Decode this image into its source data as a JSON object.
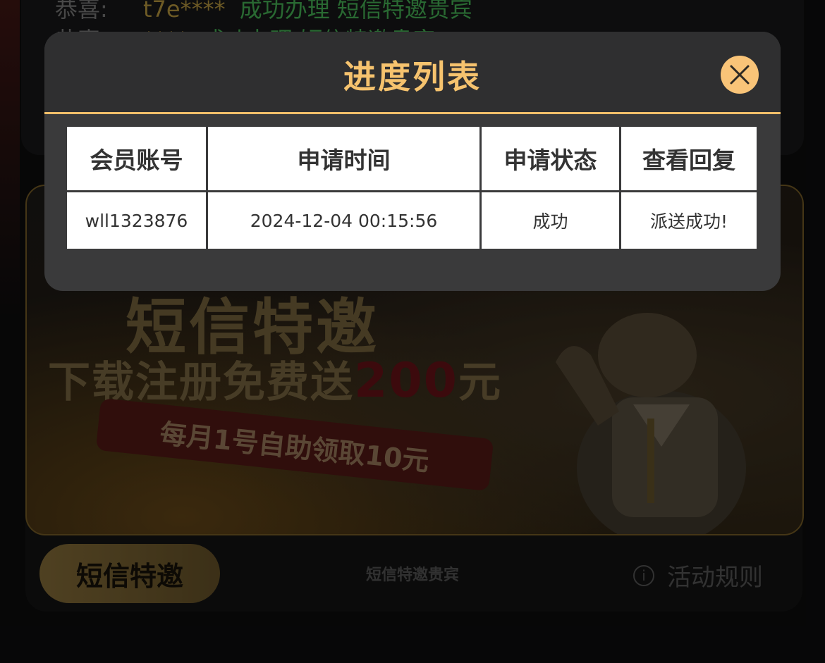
{
  "background": {
    "ticker": [
      {
        "name": "恭喜:",
        "account": "t7e****",
        "message": "成功办理 短信特邀贵宾"
      },
      {
        "name": "恭喜:",
        "account": "****",
        "message": "成功办理 短信特邀贵宾"
      }
    ],
    "banner": {
      "headline": "短信特邀",
      "promo_text": "下载注册免费送",
      "promo_amount": "200",
      "promo_unit": "元",
      "ribbon_text": "每月1号自助领取10元"
    },
    "footer": {
      "button_label": "短信特邀",
      "caption": "短信特邀贵宾",
      "rules_label": "活动规则",
      "info_icon": "i"
    }
  },
  "modal": {
    "title": "进度列表",
    "close_icon": "close-icon",
    "accent_color": "#f6c36e",
    "table": {
      "columns": [
        "会员账号",
        "申请时间",
        "申请状态",
        "查看回复"
      ],
      "rows": [
        [
          "wll1323876",
          "2024-12-04 00:15:56",
          "成功",
          "派送成功!"
        ]
      ]
    }
  }
}
